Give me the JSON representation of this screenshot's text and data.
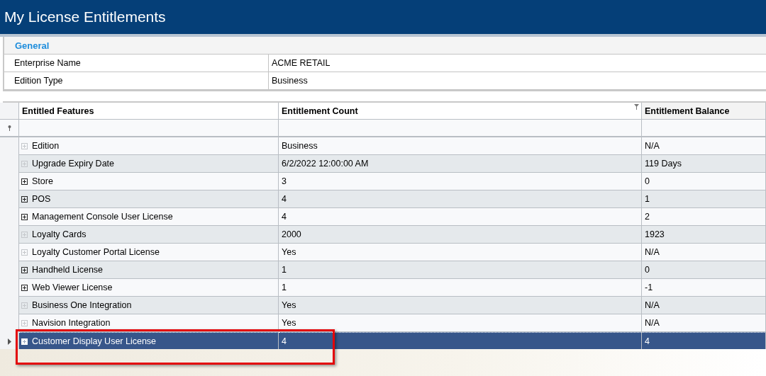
{
  "window": {
    "title": "My License Entitlements"
  },
  "general": {
    "heading": "General",
    "rows": [
      {
        "label": "Enterprise Name",
        "value": "ACME RETAIL"
      },
      {
        "label": "Edition Type",
        "value": "Business"
      }
    ]
  },
  "table": {
    "columns": [
      "Entitled Features",
      "Entitlement Count",
      "Entitlement Balance"
    ],
    "rows": [
      {
        "feature": "Edition",
        "count": "Business",
        "balance": "N/A",
        "expandable": false,
        "selected": false
      },
      {
        "feature": "Upgrade Expiry Date",
        "count": "6/2/2022 12:00:00 AM",
        "balance": "119 Days",
        "expandable": false,
        "selected": false
      },
      {
        "feature": "Store",
        "count": "3",
        "balance": "0",
        "expandable": true,
        "selected": false
      },
      {
        "feature": "POS",
        "count": "4",
        "balance": "1",
        "expandable": true,
        "selected": false
      },
      {
        "feature": "Management Console User License",
        "count": "4",
        "balance": "2",
        "expandable": true,
        "selected": false
      },
      {
        "feature": "Loyalty Cards",
        "count": "2000",
        "balance": "1923",
        "expandable": false,
        "selected": false
      },
      {
        "feature": "Loyalty Customer Portal License",
        "count": "Yes",
        "balance": "N/A",
        "expandable": false,
        "selected": false
      },
      {
        "feature": "Handheld License",
        "count": "1",
        "balance": "0",
        "expandable": true,
        "selected": false
      },
      {
        "feature": "Web Viewer License",
        "count": "1",
        "balance": "-1",
        "expandable": true,
        "selected": false
      },
      {
        "feature": "Business One Integration",
        "count": "Yes",
        "balance": "N/A",
        "expandable": false,
        "selected": false
      },
      {
        "feature": "Navision Integration",
        "count": "Yes",
        "balance": "N/A",
        "expandable": false,
        "selected": false
      },
      {
        "feature": "Customer Display User License",
        "count": "4",
        "balance": "4",
        "expandable": true,
        "selected": true
      }
    ]
  }
}
